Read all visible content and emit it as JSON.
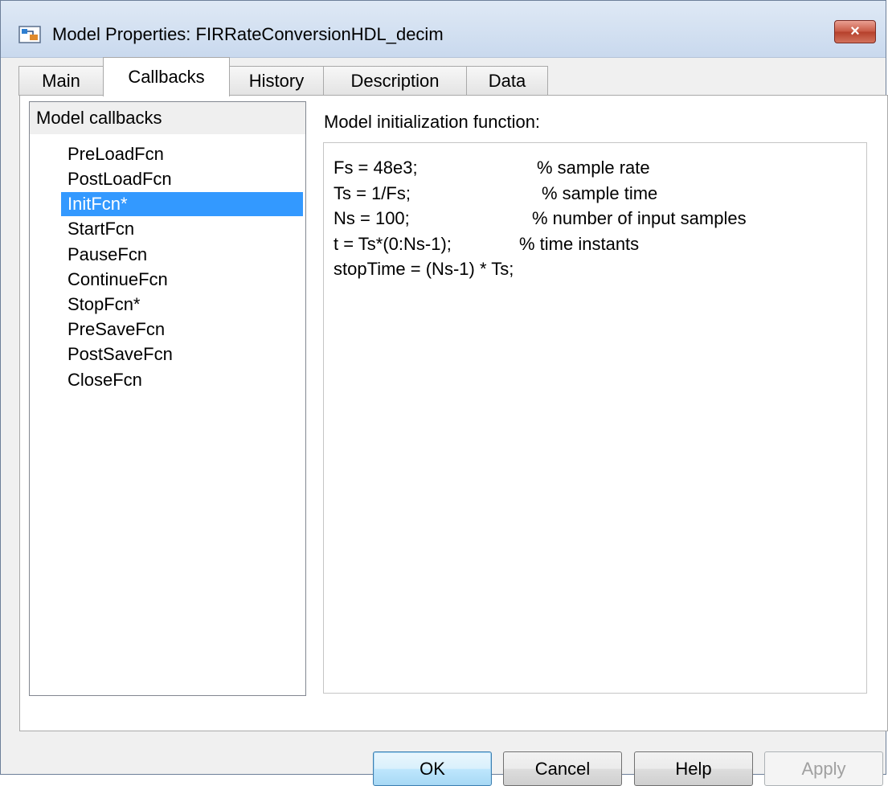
{
  "window": {
    "title": "Model Properties: FIRRateConversionHDL_decim",
    "close_glyph": "×"
  },
  "tabs": [
    {
      "label": "Main"
    },
    {
      "label": "Callbacks"
    },
    {
      "label": "History"
    },
    {
      "label": "Description"
    },
    {
      "label": "Data"
    }
  ],
  "active_tab": "Callbacks",
  "callbacks_panel": {
    "header": "Model callbacks",
    "items": [
      {
        "label": "PreLoadFcn"
      },
      {
        "label": "PostLoadFcn"
      },
      {
        "label": "InitFcn*"
      },
      {
        "label": "StartFcn"
      },
      {
        "label": "PauseFcn"
      },
      {
        "label": "ContinueFcn"
      },
      {
        "label": "StopFcn*"
      },
      {
        "label": "PreSaveFcn"
      },
      {
        "label": "PostSaveFcn"
      },
      {
        "label": "CloseFcn"
      }
    ],
    "selected": "InitFcn*"
  },
  "editor": {
    "label": "Model initialization function:",
    "lines": [
      {
        "code": "Fs = 48e3;",
        "comment": "% sample rate"
      },
      {
        "code": "Ts = 1/Fs;",
        "comment": "% sample time"
      },
      {
        "code": "Ns = 100;",
        "comment": "% number of input samples"
      },
      {
        "code": "t = Ts*(0:Ns-1);",
        "comment": "% time instants"
      },
      {
        "code": "stopTime = (Ns-1) * Ts;",
        "comment": ""
      }
    ]
  },
  "buttons": {
    "ok": "OK",
    "cancel": "Cancel",
    "help": "Help",
    "apply": "Apply"
  },
  "colors": {
    "selection": "#3399ff",
    "close_button": "#c75843"
  }
}
